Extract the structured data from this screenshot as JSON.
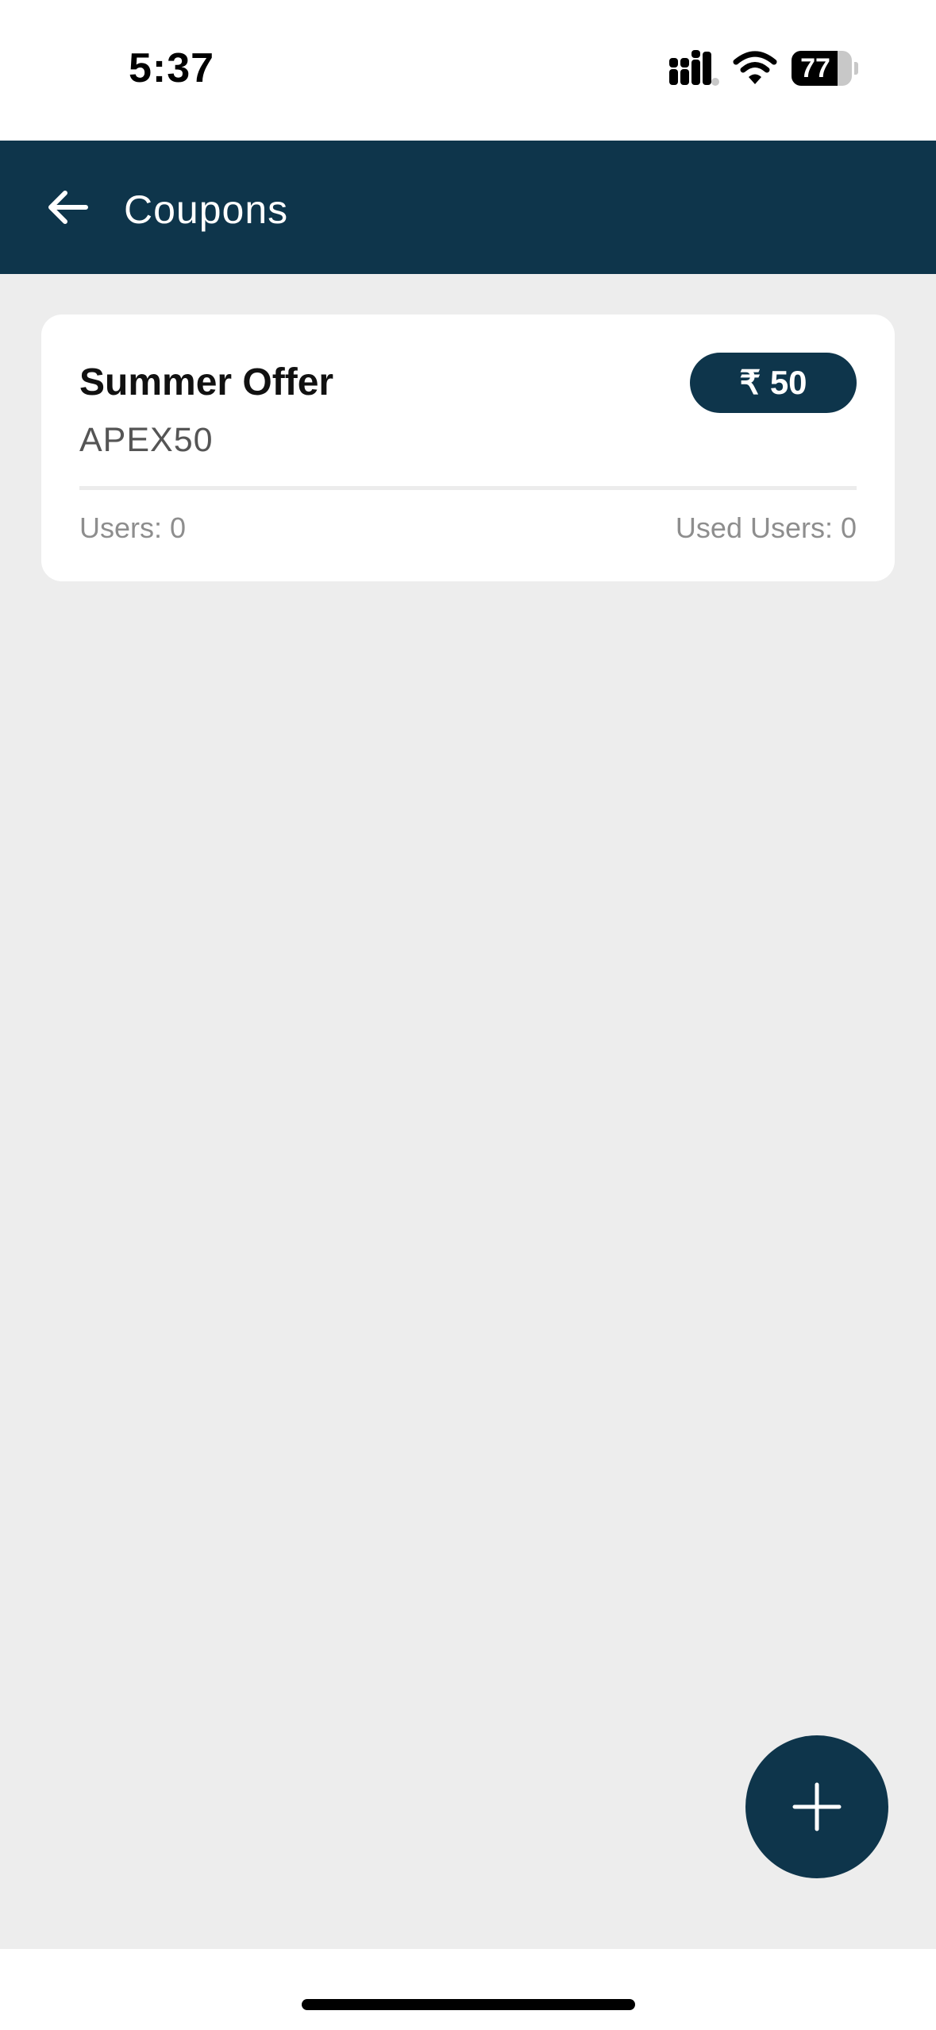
{
  "status_bar": {
    "time": "5:37",
    "battery_level": "77",
    "icons": [
      "signal-icon",
      "wifi-icon",
      "battery-icon"
    ]
  },
  "header": {
    "title": "Coupons",
    "back_icon": "arrow-left-icon",
    "background_color": "#0e354b",
    "text_color": "#ffffff"
  },
  "coupons": [
    {
      "name": "Summer Offer",
      "code": "APEX50",
      "amount": "₹ 50",
      "users": "Users: 0",
      "used_users": "Used Users: 0"
    }
  ],
  "fab": {
    "icon": "plus-icon",
    "color": "#0e354b"
  },
  "colors": {
    "background": "#ededed",
    "card": "#ffffff",
    "accent": "#0e354b"
  }
}
